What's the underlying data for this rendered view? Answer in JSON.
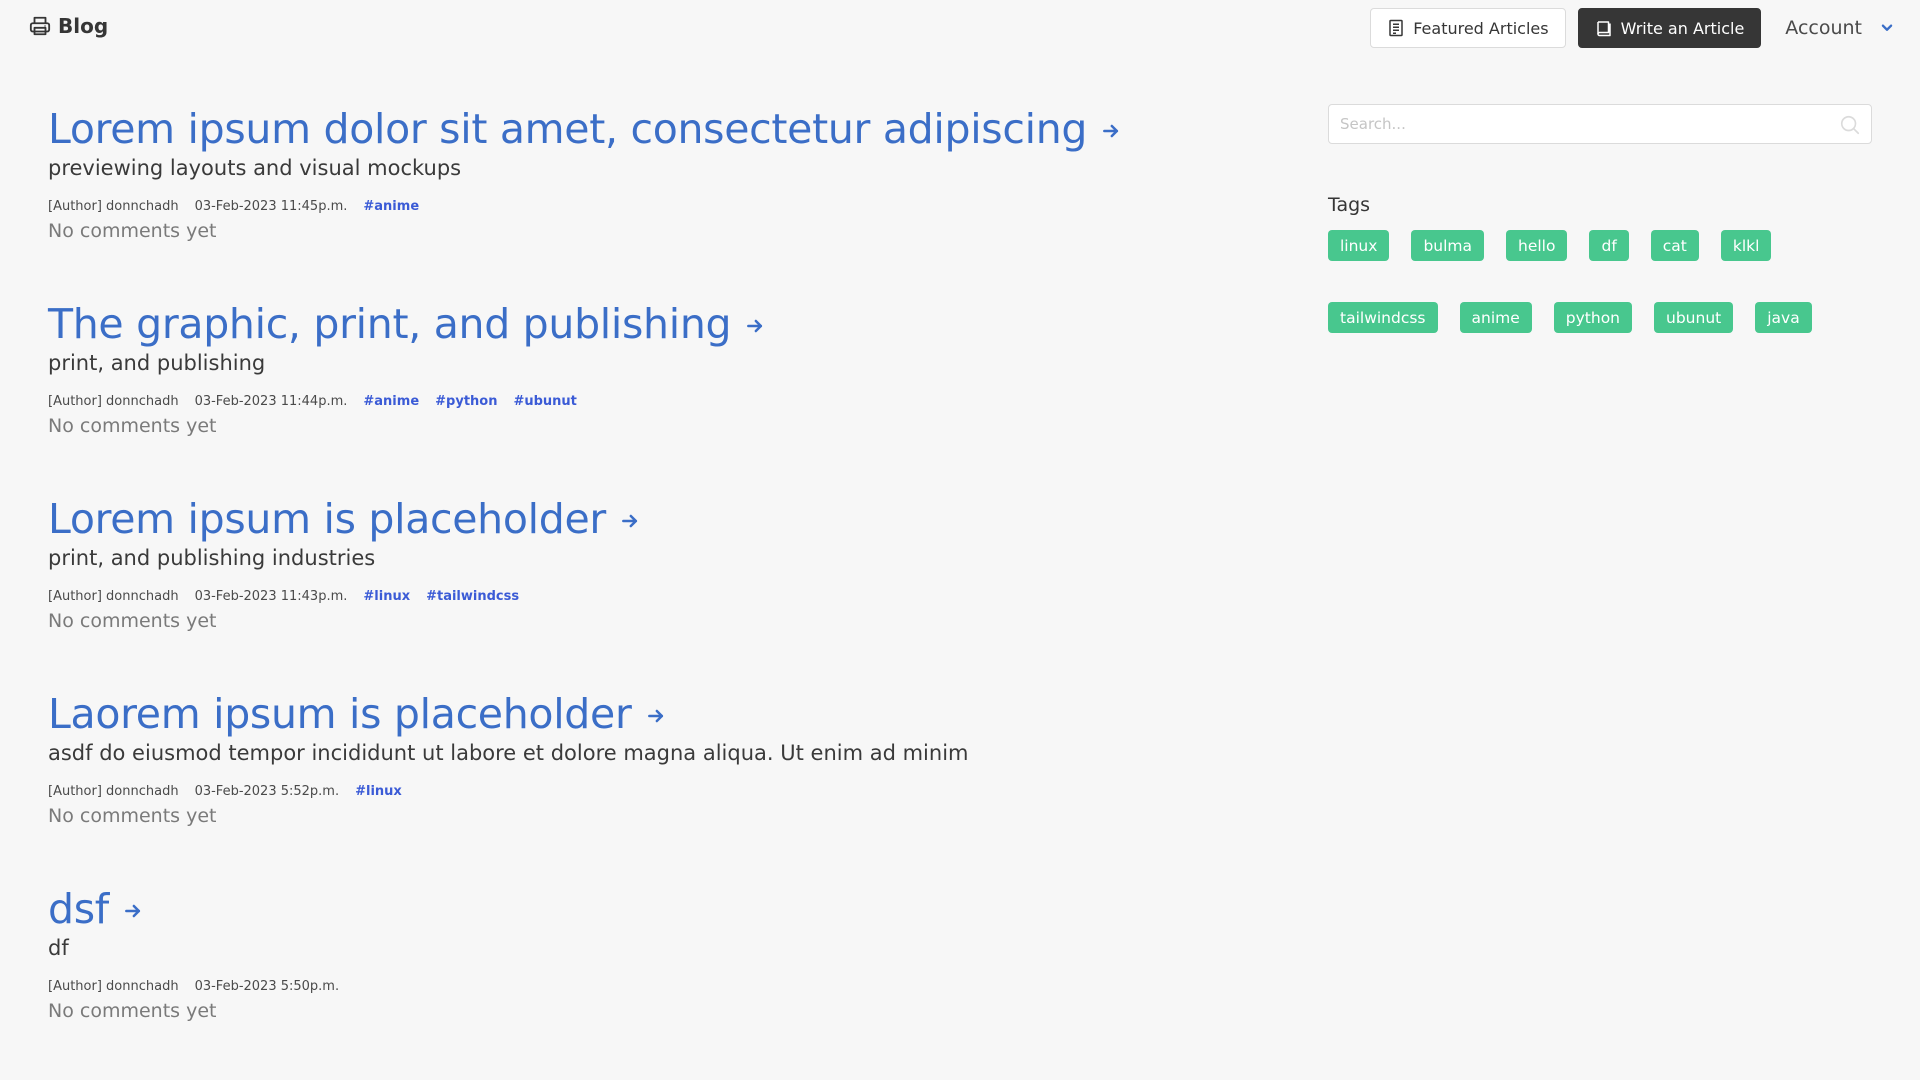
{
  "navbar": {
    "brand": "Blog",
    "featured_label": "Featured Articles",
    "write_label": "Write an Article",
    "account_label": "Account"
  },
  "articles": [
    {
      "title": "Lorem ipsum dolor sit amet, consectetur adipiscing",
      "subtitle": "previewing layouts and visual mockups",
      "author": "[Author] donnchadh",
      "date": "03-Feb-2023 11:45p.m.",
      "tags": [
        "#anime"
      ],
      "comments": "No comments yet"
    },
    {
      "title": "The graphic, print, and publishing",
      "subtitle": "print, and publishing",
      "author": "[Author] donnchadh",
      "date": "03-Feb-2023 11:44p.m.",
      "tags": [
        "#anime",
        "#python",
        "#ubunut"
      ],
      "comments": "No comments yet"
    },
    {
      "title": "Lorem ipsum is placeholder",
      "subtitle": "print, and publishing industries",
      "author": "[Author] donnchadh",
      "date": "03-Feb-2023 11:43p.m.",
      "tags": [
        "#linux",
        "#tailwindcss"
      ],
      "comments": "No comments yet"
    },
    {
      "title": "Laorem ipsum is placeholder",
      "subtitle": "asdf do eiusmod tempor incididunt ut labore et dolore magna aliqua. Ut enim ad minim",
      "author": "[Author] donnchadh",
      "date": "03-Feb-2023 5:52p.m.",
      "tags": [
        "#linux"
      ],
      "comments": "No comments yet"
    },
    {
      "title": "dsf",
      "subtitle": "df",
      "author": "[Author] donnchadh",
      "date": "03-Feb-2023 5:50p.m.",
      "tags": [],
      "comments": "No comments yet"
    }
  ],
  "sidebar": {
    "search_placeholder": "Search...",
    "tags_heading": "Tags",
    "tag_rows": [
      [
        "linux",
        "bulma",
        "hello",
        "df",
        "cat",
        "klkl"
      ],
      [
        "tailwindcss",
        "anime",
        "python",
        "ubunut",
        "java"
      ]
    ]
  },
  "colors": {
    "title_link": "#3b6ec7",
    "tag_link": "#3b5bd6",
    "tag_bg": "#48c78e",
    "dark_button": "#363636",
    "background": "#f7f7f7"
  },
  "icons": {
    "brand": "printer-icon",
    "featured": "list-document-icon",
    "write": "book-icon",
    "account": "chevron-down-icon",
    "title_arrow": "arrow-right-icon",
    "search": "search-icon"
  }
}
